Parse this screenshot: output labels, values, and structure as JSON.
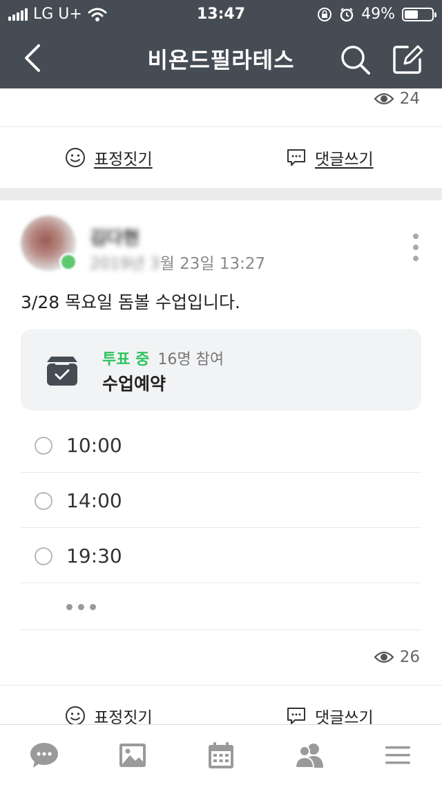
{
  "status_bar": {
    "carrier": "LG U+",
    "time": "13:47",
    "battery_pct": "49%",
    "battery_level": 0.49
  },
  "header": {
    "title": "비욘드필라테스"
  },
  "prev_post": {
    "views": "24",
    "emote_label": "표정짓기",
    "comment_label": "댓글쓰기"
  },
  "post": {
    "author": "김다현",
    "date_hidden": "2019년 3",
    "date_visible": "월 23일 13:27",
    "body": "3/28 목요일 돔볼 수업입니다.",
    "poll": {
      "status": "투표 중",
      "participants": "16명 참여",
      "title": "수업예약",
      "options": [
        "10:00",
        "14:00",
        "19:30"
      ]
    },
    "views": "26",
    "emote_label": "표정짓기",
    "comment_label": "댓글쓰기"
  },
  "tab_bar": {
    "tabs": [
      "chat-icon",
      "photo-icon",
      "calendar-icon",
      "members-icon",
      "menu-icon"
    ]
  },
  "colors": {
    "header_bg": "#464c54",
    "poll_active": "#2ec45c",
    "tab_icon": "#9a9a9a"
  }
}
